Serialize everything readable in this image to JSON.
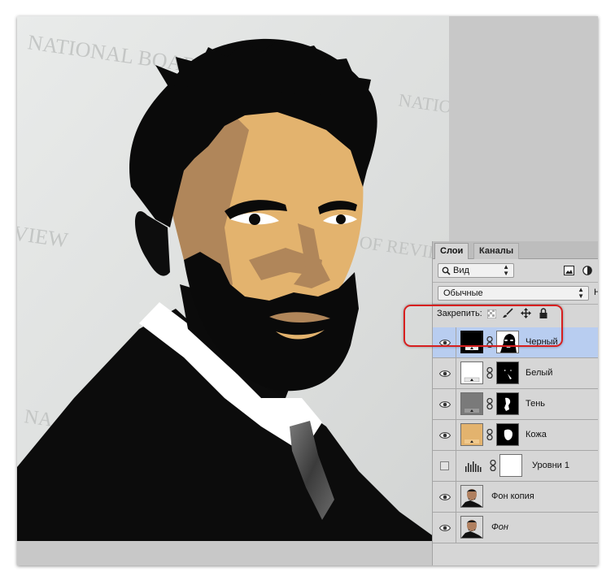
{
  "colors": {
    "skin": "#e3b36e",
    "shadow": "#b0865a",
    "selected_row": "#b8cdf0",
    "highlight": "#d71f1f"
  },
  "canvas": {
    "background_text": [
      "NATIONAL BOARD OF",
      "NATIO",
      "VIEW",
      "OF REVIEW",
      "NA"
    ]
  },
  "panel": {
    "tabs": [
      "Слои",
      "Каналы"
    ],
    "filter": {
      "icon": "search-icon",
      "label": "Вид"
    },
    "blend_mode": "Обычные",
    "opacity_cut": "Н",
    "lock_label": "Закрепить:",
    "layers": [
      {
        "name": "Черный",
        "visible": true,
        "selected": true,
        "italic": false,
        "thumb": "black-fill",
        "mask": "black-mask"
      },
      {
        "name": "Белый",
        "visible": true,
        "selected": false,
        "italic": false,
        "thumb": "white-fill",
        "mask": "white-mask"
      },
      {
        "name": "Тень",
        "visible": true,
        "selected": false,
        "italic": false,
        "thumb": "gray-fill",
        "mask": "shadow-mask"
      },
      {
        "name": "Кожа",
        "visible": true,
        "selected": false,
        "italic": false,
        "thumb": "skin-fill",
        "mask": "skin-mask"
      },
      {
        "name": "Уровни 1",
        "visible": false,
        "selected": false,
        "italic": false,
        "thumb": "levels-icon",
        "mask": "white-mask-full"
      },
      {
        "name": "Фон копия",
        "visible": true,
        "selected": false,
        "italic": false,
        "thumb": "photo"
      },
      {
        "name": "Фон",
        "visible": true,
        "selected": false,
        "italic": true,
        "thumb": "photo"
      }
    ]
  }
}
